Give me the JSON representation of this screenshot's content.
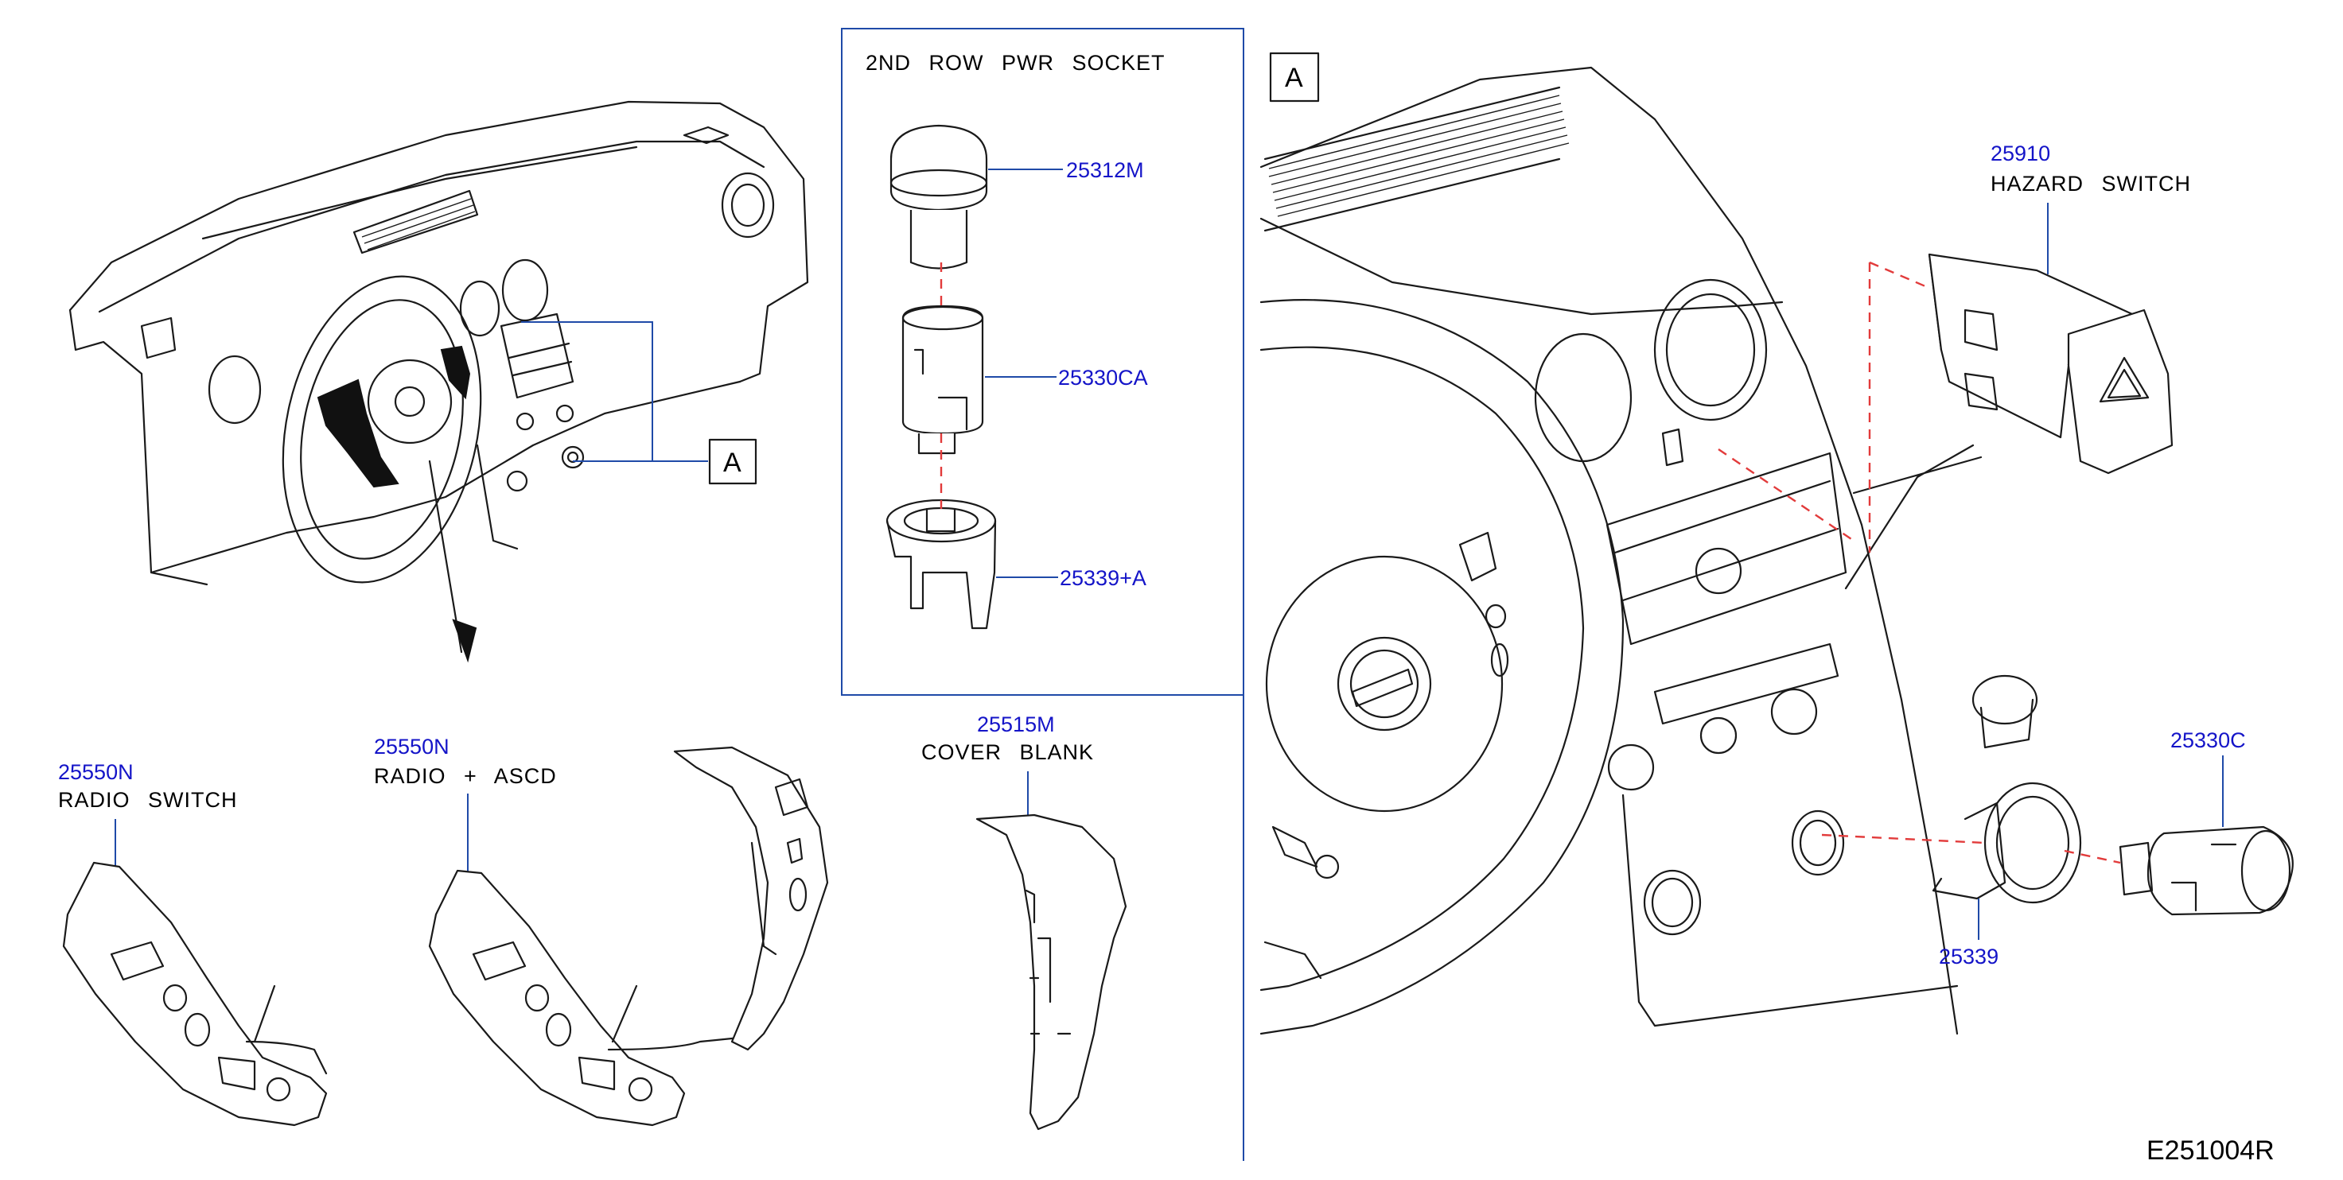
{
  "diagram_code": "E251004R",
  "callouts": {
    "view_a_marker": "A",
    "view_a_title": "A"
  },
  "inset_2nd_row": {
    "title": "2ND ROW PWR SOCKET",
    "parts": [
      {
        "number": "25312M"
      },
      {
        "number": "25330CA"
      },
      {
        "number": "25339+A"
      }
    ]
  },
  "parts": {
    "radio_switch": {
      "number": "25550N",
      "name": "RADIO SWITCH"
    },
    "radio_ascd": {
      "number": "25550N",
      "name": "RADIO + ASCD"
    },
    "cover_blank": {
      "number": "25515M",
      "name": "COVER BLANK"
    },
    "hazard_switch": {
      "number": "25910",
      "name": "HAZARD SWITCH"
    },
    "socket_25330c": {
      "number": "25330C"
    },
    "socket_25339": {
      "number": "25339"
    }
  },
  "colors": {
    "part_number": "#1414c8",
    "leader_line": "#1f4aa8",
    "hidden_line": "#e23b3b",
    "outline": "#1a1a1a"
  }
}
